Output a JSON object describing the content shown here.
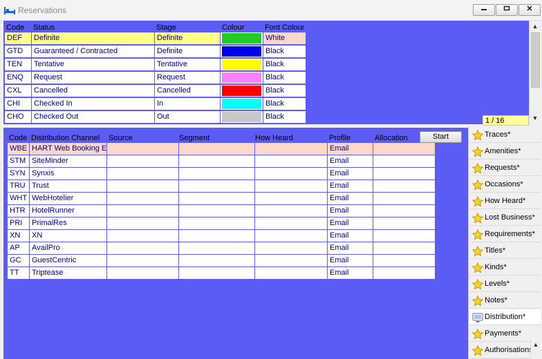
{
  "window": {
    "title": "Reservations"
  },
  "status_grid": {
    "headers": [
      "Code",
      "Status",
      "Stage",
      "Colour",
      "Font Colour"
    ],
    "rows": [
      {
        "code": "DEF",
        "status": "Definite",
        "stage": "Definite",
        "colour": "#22cc22",
        "font_colour": "White",
        "highlight": true
      },
      {
        "code": "GTD",
        "status": "Guaranteed / Contracted",
        "stage": "Definite",
        "colour": "#0000ee",
        "font_colour": "Black"
      },
      {
        "code": "TEN",
        "status": "Tentative",
        "stage": "Tentative",
        "colour": "#ffff00",
        "font_colour": "Black"
      },
      {
        "code": "ENQ",
        "status": "Request",
        "stage": "Request",
        "colour": "#ff80ff",
        "font_colour": "Black"
      },
      {
        "code": "CXL",
        "status": "Cancelled",
        "stage": "Cancelled",
        "colour": "#ff0000",
        "font_colour": "Black"
      },
      {
        "code": "CHI",
        "status": "Checked In",
        "stage": "In",
        "colour": "#00ffff",
        "font_colour": "Black"
      },
      {
        "code": "CHO",
        "status": "Checked Out",
        "stage": "Out",
        "colour": "#c8c8c8",
        "font_colour": "Black"
      }
    ],
    "pager": "1 / 16"
  },
  "distribution_grid": {
    "headers": [
      "Code",
      "Distribution Channel",
      "Source",
      "Segment",
      "How Heard",
      "Profile",
      "Allocation"
    ],
    "start_label": "Start",
    "rows": [
      {
        "code": "WBE",
        "channel": "HART Web Booking Engine",
        "profile": "Email",
        "highlight": true
      },
      {
        "code": "STM",
        "channel": "SiteMinder",
        "profile": "Email"
      },
      {
        "code": "SYN",
        "channel": "Synxis",
        "profile": "Email"
      },
      {
        "code": "TRU",
        "channel": "Trust",
        "profile": "Email"
      },
      {
        "code": "WHT",
        "channel": "WebHotelier",
        "profile": "Email"
      },
      {
        "code": "HTR",
        "channel": "HotelRunner",
        "profile": "Email"
      },
      {
        "code": "PRI",
        "channel": "PrimalRes",
        "profile": "Email"
      },
      {
        "code": "XN",
        "channel": "XN",
        "profile": "Email"
      },
      {
        "code": "AP",
        "channel": "AvailPro",
        "profile": "Email"
      },
      {
        "code": "GC",
        "channel": "GuestCentric",
        "profile": "Email"
      },
      {
        "code": "TT",
        "channel": "Triptease",
        "profile": "Email"
      }
    ]
  },
  "sidebar": {
    "items": [
      {
        "label": "Traces*",
        "icon": "star-icon"
      },
      {
        "label": "Amenities*",
        "icon": "star-icon"
      },
      {
        "label": "Requests*",
        "icon": "star-icon"
      },
      {
        "label": "Occasions*",
        "icon": "star-icon"
      },
      {
        "label": "How Heard*",
        "icon": "star-icon"
      },
      {
        "label": "Lost Business*",
        "icon": "star-icon"
      },
      {
        "label": "Requirements*",
        "icon": "star-icon"
      },
      {
        "label": "Titles*",
        "icon": "star-icon"
      },
      {
        "label": "Kinds*",
        "icon": "star-icon"
      },
      {
        "label": "Levels*",
        "icon": "star-icon"
      },
      {
        "label": "Notes*",
        "icon": "star-icon"
      },
      {
        "label": "Distribution*",
        "icon": "distribution-icon",
        "active": true
      },
      {
        "label": "Payments*",
        "icon": "star-icon"
      },
      {
        "label": "Authorisations",
        "icon": "star-icon"
      }
    ]
  },
  "colors": {
    "panel_bg": "#5b5bf5",
    "highlight_row": "#fdd8c8",
    "cell_text": "#00007a"
  }
}
